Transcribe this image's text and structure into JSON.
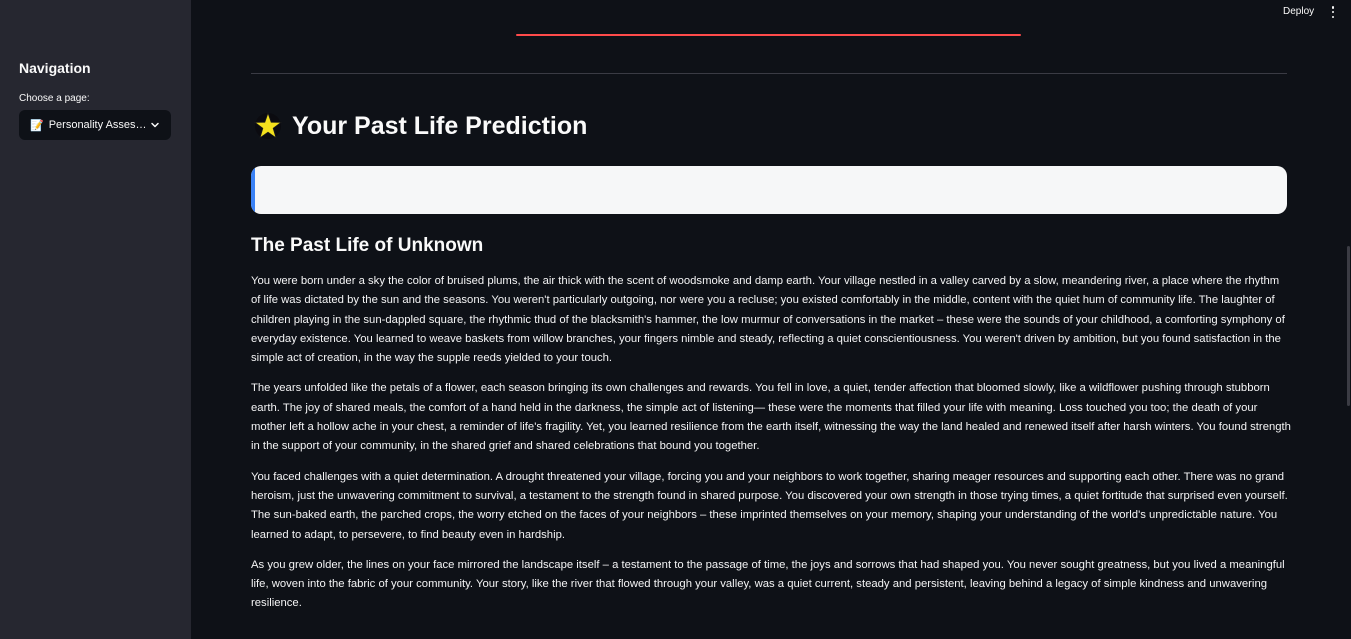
{
  "sidebar": {
    "title": "Navigation",
    "select_label": "Choose a page:",
    "selected_page": "Personality Assessment",
    "selected_icon": "📝"
  },
  "header": {
    "deploy_label": "Deploy"
  },
  "main": {
    "heading_icon": "star-icon",
    "heading": "Your Past Life Prediction",
    "subheading": "The Past Life of Unknown",
    "paragraphs": [
      "You were born under a sky the color of bruised plums, the air thick with the scent of woodsmoke and damp earth. Your village nestled in a valley carved by a slow, meandering river, a place where the rhythm of life was dictated by the sun and the seasons. You weren't particularly outgoing, nor were you a recluse; you existed comfortably in the middle, content with the quiet hum of community life. The laughter of children playing in the sun-dappled square, the rhythmic thud of the blacksmith's hammer, the low murmur of conversations in the market – these were the sounds of your childhood, a comforting symphony of everyday existence. You learned to weave baskets from willow branches, your fingers nimble and steady, reflecting a quiet conscientiousness. You weren't driven by ambition, but you found satisfaction in the simple act of creation, in the way the supple reeds yielded to your touch.",
      "The years unfolded like the petals of a flower, each season bringing its own challenges and rewards. You fell in love, a quiet, tender affection that bloomed slowly, like a wildflower pushing through stubborn earth. The joy of shared meals, the comfort of a hand held in the darkness, the simple act of listening— these were the moments that filled your life with meaning. Loss touched you too; the death of your mother left a hollow ache in your chest, a reminder of life's fragility. Yet, you learned resilience from the earth itself, witnessing the way the land healed and renewed itself after harsh winters. You found strength in the support of your community, in the shared grief and shared celebrations that bound you together.",
      "You faced challenges with a quiet determination. A drought threatened your village, forcing you and your neighbors to work together, sharing meager resources and supporting each other. There was no grand heroism, just the unwavering commitment to survival, a testament to the strength found in shared purpose. You discovered your own strength in those trying times, a quiet fortitude that surprised even yourself. The sun-baked earth, the parched crops, the worry etched on the faces of your neighbors – these imprinted themselves on your memory, shaping your understanding of the world's unpredictable nature. You learned to adapt, to persevere, to find beauty even in hardship.",
      "As you grew older, the lines on your face mirrored the landscape itself – a testament to the passage of time, the joys and sorrows that had shaped you. You never sought greatness, but you lived a meaningful life, woven into the fabric of your community. Your story, like the river that flowed through your valley, was a quiet current, steady and persistent, leaving behind a legacy of simple kindness and unwavering resilience."
    ]
  },
  "colors": {
    "app_bg": "#0e1117",
    "sidebar_bg": "#262730",
    "accent_red": "#ff4b4b",
    "info_bg": "#f6f7f8",
    "info_accent": "#3b82f6"
  }
}
